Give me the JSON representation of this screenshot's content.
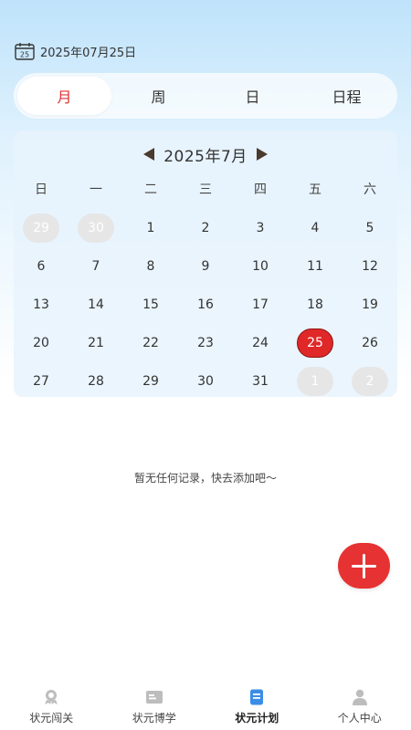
{
  "header": {
    "date_text": "2025年07月25日",
    "calendar_icon_text": "25"
  },
  "tabs": [
    {
      "label": "月",
      "active": true
    },
    {
      "label": "周",
      "active": false
    },
    {
      "label": "日",
      "active": false
    },
    {
      "label": "日程",
      "active": false
    }
  ],
  "calendar": {
    "month_title": "2025年7月",
    "weekdays": [
      "日",
      "一",
      "二",
      "三",
      "四",
      "五",
      "六"
    ],
    "days": [
      {
        "n": "29",
        "other": true
      },
      {
        "n": "30",
        "other": true
      },
      {
        "n": "1"
      },
      {
        "n": "2"
      },
      {
        "n": "3"
      },
      {
        "n": "4"
      },
      {
        "n": "5"
      },
      {
        "n": "6"
      },
      {
        "n": "7"
      },
      {
        "n": "8"
      },
      {
        "n": "9"
      },
      {
        "n": "10"
      },
      {
        "n": "11"
      },
      {
        "n": "12"
      },
      {
        "n": "13"
      },
      {
        "n": "14"
      },
      {
        "n": "15"
      },
      {
        "n": "16"
      },
      {
        "n": "17"
      },
      {
        "n": "18"
      },
      {
        "n": "19"
      },
      {
        "n": "20"
      },
      {
        "n": "21"
      },
      {
        "n": "22"
      },
      {
        "n": "23"
      },
      {
        "n": "24"
      },
      {
        "n": "25",
        "today": true
      },
      {
        "n": "26"
      },
      {
        "n": "27"
      },
      {
        "n": "28"
      },
      {
        "n": "29"
      },
      {
        "n": "30"
      },
      {
        "n": "31"
      },
      {
        "n": "1",
        "other": true
      },
      {
        "n": "2",
        "other": true
      }
    ]
  },
  "empty_message": "暂无任何记录，快去添加吧～",
  "bottom_nav": [
    {
      "label": "状元闯关",
      "icon": "trophy-icon",
      "active": false
    },
    {
      "label": "状元博学",
      "icon": "book-icon",
      "active": false
    },
    {
      "label": "状元计划",
      "icon": "plan-icon",
      "active": true
    },
    {
      "label": "个人中心",
      "icon": "person-icon",
      "active": false
    }
  ],
  "colors": {
    "accent": "#e02828",
    "active_nav": "#3a8ee6"
  }
}
